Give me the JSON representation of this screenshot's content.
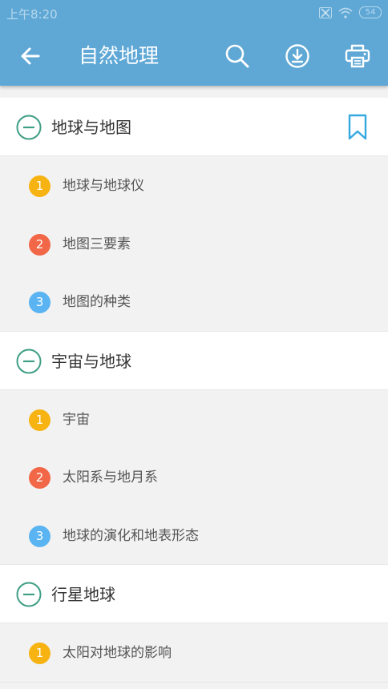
{
  "status_bar": {
    "time": "上午8:20",
    "battery": "54"
  },
  "header": {
    "title": "自然地理"
  },
  "colors": {
    "appbar": "#5fa8d6",
    "accent_green": "#3f9e85",
    "bookmark_blue": "#36a9e0"
  },
  "sections": [
    {
      "title": "地球与地图",
      "items": [
        {
          "num": "1",
          "title": "地球与地球仪"
        },
        {
          "num": "2",
          "title": "地图三要素"
        },
        {
          "num": "3",
          "title": "地图的种类"
        }
      ]
    },
    {
      "title": "宇宙与地球",
      "items": [
        {
          "num": "1",
          "title": "宇宙"
        },
        {
          "num": "2",
          "title": "太阳系与地月系"
        },
        {
          "num": "3",
          "title": "地球的演化和地表形态"
        }
      ]
    },
    {
      "title": "行星地球",
      "items": [
        {
          "num": "1",
          "title": "太阳对地球的影响"
        }
      ]
    }
  ]
}
